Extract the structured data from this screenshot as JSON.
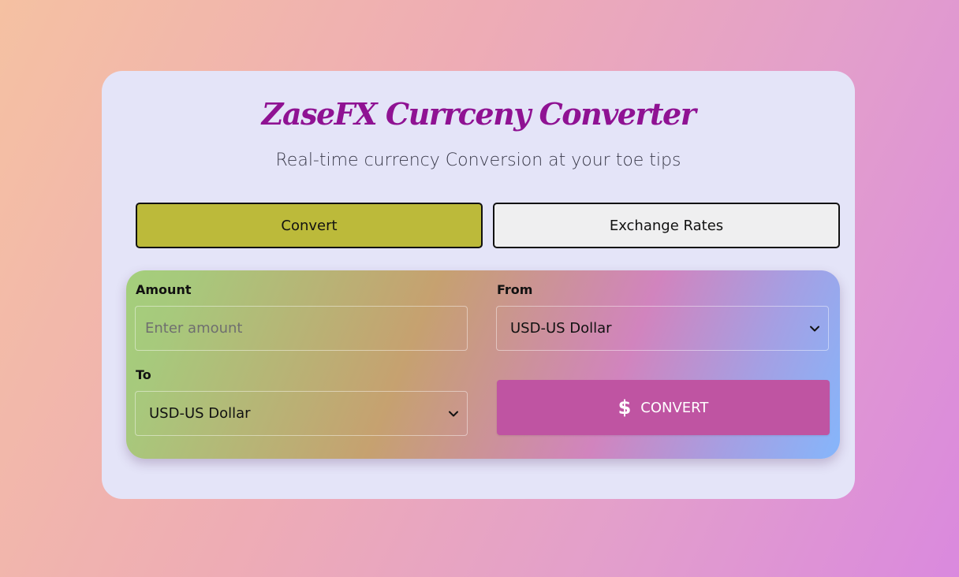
{
  "app": {
    "title": "ZaseFX Currceny Converter",
    "subtitle": "Real-time currency Conversion at your toe tips"
  },
  "tabs": [
    {
      "label": "Convert",
      "active": true,
      "color": "#bcba3a"
    },
    {
      "label": "Exchange Rates",
      "active": false,
      "color": "#efeff0"
    }
  ],
  "form": {
    "amount": {
      "label": "Amount",
      "value": "",
      "placeholder": "Enter amount"
    },
    "from": {
      "label": "From",
      "selected": "USD-US Dollar"
    },
    "to": {
      "label": "To",
      "selected": "USD-US Dollar"
    },
    "convert_button": {
      "label": "CONVERT",
      "icon": "dollar-icon",
      "color": "#bf54a2"
    }
  },
  "colors": {
    "title": "#8f1293",
    "card_background": "#e4e4f8"
  }
}
